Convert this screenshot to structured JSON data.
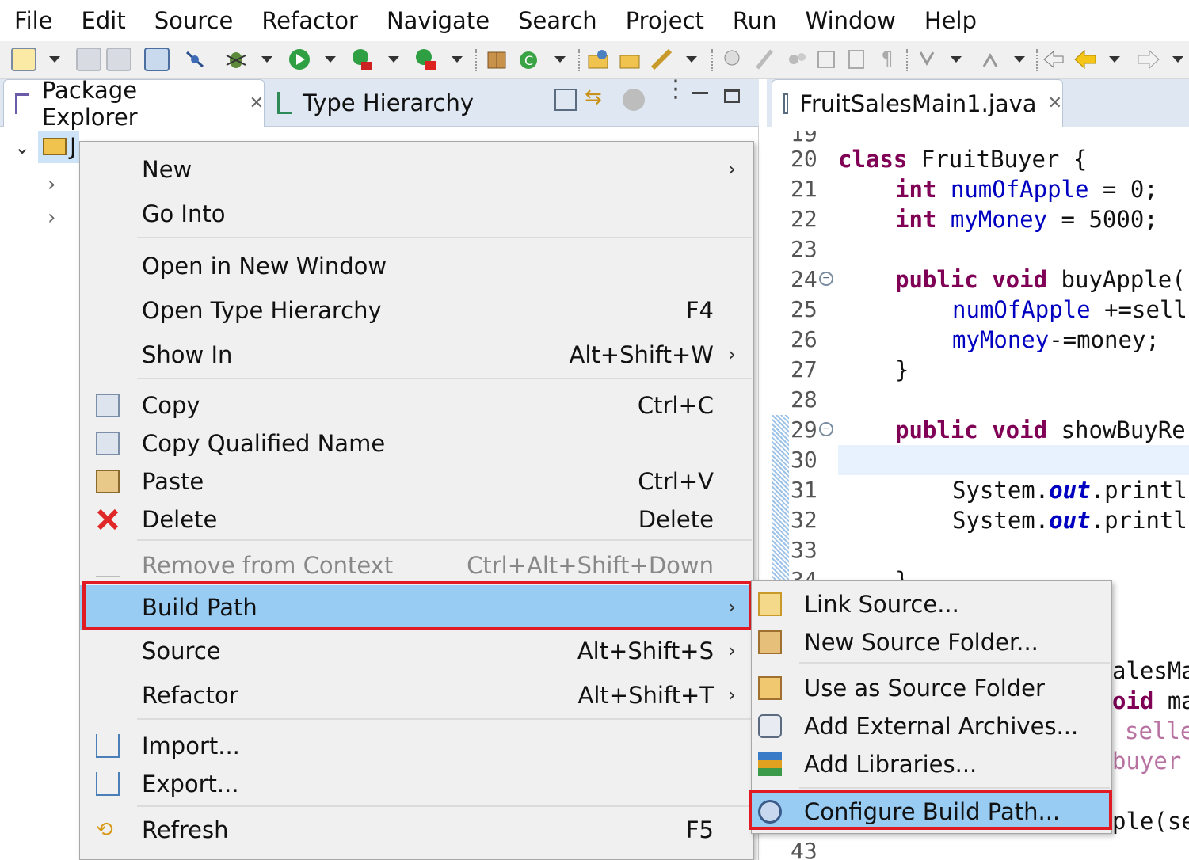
{
  "menubar": {
    "items": [
      "File",
      "Edit",
      "Source",
      "Refactor",
      "Navigate",
      "Search",
      "Project",
      "Run",
      "Window",
      "Help"
    ]
  },
  "left_view": {
    "tabs": [
      {
        "label": "Package Explorer"
      },
      {
        "label": "Type Hierarchy"
      }
    ],
    "tree": {
      "project_label": "J"
    }
  },
  "editor": {
    "tab_label": "FruitSalesMain1.java",
    "line_numbers": [
      "19",
      "20",
      "21",
      "22",
      "23",
      "24",
      "25",
      "26",
      "27",
      "28",
      "29",
      "30",
      "31",
      "32",
      "33",
      "34",
      "43"
    ],
    "code": {
      "l20_kw": "class",
      "l20_rest": " FruitBuyer {",
      "l21_kw": "int",
      "l21_fd": "numOfApple",
      "l21_rest": " = 0;",
      "l22_kw": "int",
      "l22_fd": "myMoney",
      "l22_rest": " = 5000;",
      "l24_kw": "public void",
      "l24_rest": " buyApple(",
      "l25_fd": "numOfApple",
      "l25_rest": " +=sell",
      "l26_fd": "myMoney",
      "l26_rest": "-=money;",
      "l27": "}",
      "l29_kw": "public void",
      "l29_rest": " showBuyRe",
      "l31_a": "System.",
      "l31_st": "out",
      "l31_b": ".printl",
      "l32_a": "System.",
      "l32_st": "out",
      "l32_b": ".printl",
      "l34": "}",
      "frag1": "alesMa",
      "frag2": "oid",
      "frag2b": " ma",
      "frag3": "selle",
      "frag4": "buyer",
      "frag5": "ple(se"
    }
  },
  "context_menu": {
    "items": [
      {
        "label": "New",
        "accel": ""
      },
      {
        "label": "Go Into",
        "accel": ""
      },
      {
        "label": "Open in New Window",
        "accel": ""
      },
      {
        "label": "Open Type Hierarchy",
        "accel": "F4"
      },
      {
        "label": "Show In",
        "accel": "Alt+Shift+W"
      },
      {
        "label": "Copy",
        "accel": "Ctrl+C"
      },
      {
        "label": "Copy Qualified Name",
        "accel": ""
      },
      {
        "label": "Paste",
        "accel": "Ctrl+V"
      },
      {
        "label": "Delete",
        "accel": "Delete"
      },
      {
        "label": "Remove from Context",
        "accel": "Ctrl+Alt+Shift+Down"
      },
      {
        "label": "Build Path",
        "accel": ""
      },
      {
        "label": "Source",
        "accel": "Alt+Shift+S"
      },
      {
        "label": "Refactor",
        "accel": "Alt+Shift+T"
      },
      {
        "label": "Import...",
        "accel": ""
      },
      {
        "label": "Export...",
        "accel": ""
      },
      {
        "label": "Refresh",
        "accel": "F5"
      }
    ],
    "submenu_arrow": "›"
  },
  "build_path_submenu": {
    "items": [
      {
        "label": "Link Source..."
      },
      {
        "label": "New Source Folder..."
      },
      {
        "label": "Use as Source Folder"
      },
      {
        "label": "Add External Archives..."
      },
      {
        "label": "Add Libraries..."
      },
      {
        "label": "Configure Build Path..."
      }
    ]
  },
  "colors": {
    "highlight": "#99ccf3",
    "annotation_red": "#e01b24",
    "keyword": "#7f0055",
    "field": "#0000c0"
  }
}
